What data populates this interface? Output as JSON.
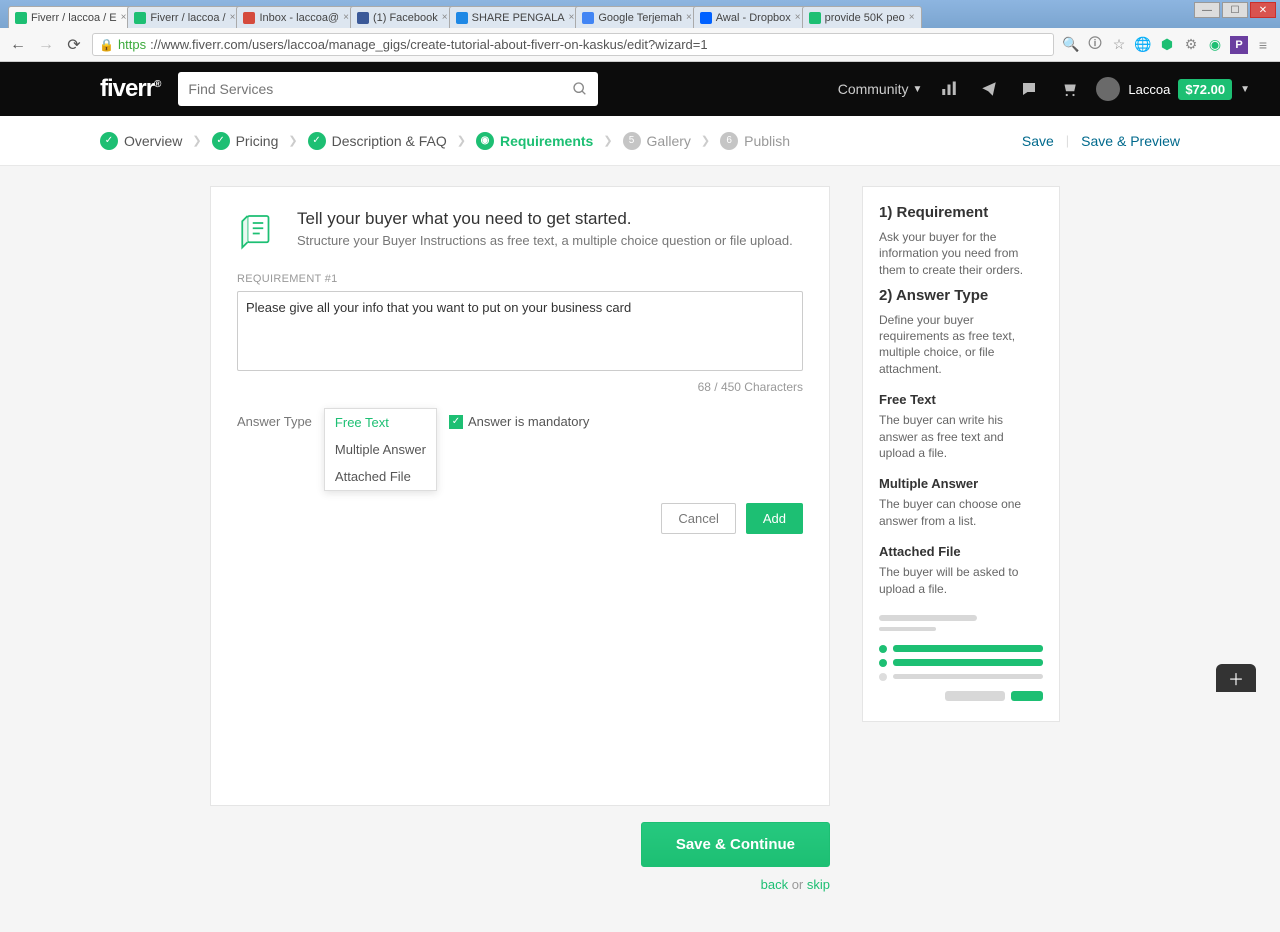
{
  "browser": {
    "tabs": [
      {
        "title": "Fiverr / laccoa / E",
        "color": "#1dbf73"
      },
      {
        "title": "Fiverr / laccoa /",
        "color": "#1dbf73"
      },
      {
        "title": "Inbox - laccoa@",
        "color": "#d54b3d"
      },
      {
        "title": "(1) Facebook",
        "color": "#3b5998"
      },
      {
        "title": "SHARE PENGALA",
        "color": "#1e88e5"
      },
      {
        "title": "Google Terjemah",
        "color": "#4285f4"
      },
      {
        "title": "Awal - Dropbox",
        "color": "#0061ff"
      },
      {
        "title": "provide 50K peo",
        "color": "#1dbf73"
      }
    ],
    "url_https": "https",
    "url_rest": "://www.fiverr.com/users/laccoa/manage_gigs/create-tutorial-about-fiverr-on-kaskus/edit?wizard=1"
  },
  "header": {
    "logo": "fiverr",
    "search_placeholder": "Find Services",
    "community": "Community",
    "username": "Laccoa",
    "balance": "$72.00"
  },
  "steps": {
    "items": [
      {
        "label": "Overview"
      },
      {
        "label": "Pricing"
      },
      {
        "label": "Description & FAQ"
      },
      {
        "label": "Requirements"
      },
      {
        "label": "Gallery",
        "num": "5"
      },
      {
        "label": "Publish",
        "num": "6"
      }
    ],
    "save": "Save",
    "save_preview": "Save & Preview"
  },
  "card": {
    "title": "Tell your buyer what you need to get started.",
    "subtitle": "Structure your Buyer Instructions as free text, a multiple choice question or file upload.",
    "req_label": "REQUIREMENT #1",
    "req_value": "Please give all your info that you want to put on your business card",
    "charcount": "68 / 450 Characters",
    "answer_type_label": "Answer Type",
    "options": {
      "free": "Free Text",
      "multi": "Multiple Answer",
      "file": "Attached File"
    },
    "mandatory": "Answer is mandatory",
    "cancel": "Cancel",
    "add": "Add"
  },
  "below": {
    "save_continue": "Save & Continue",
    "back": "back",
    "or": " or ",
    "skip": "skip"
  },
  "help": {
    "h1": "1) Requirement",
    "p1": "Ask your buyer for the information you need from them to create their orders.",
    "h2": "2) Answer Type",
    "p2": "Define your buyer requirements as free text, multiple choice, or file attachment.",
    "h3": "Free Text",
    "p3": "The buyer can write his answer as free text and upload a file.",
    "h4": "Multiple Answer",
    "p4": "The buyer can choose one answer from a list.",
    "h5": "Attached File",
    "p5": "The buyer will be asked to upload a file."
  }
}
